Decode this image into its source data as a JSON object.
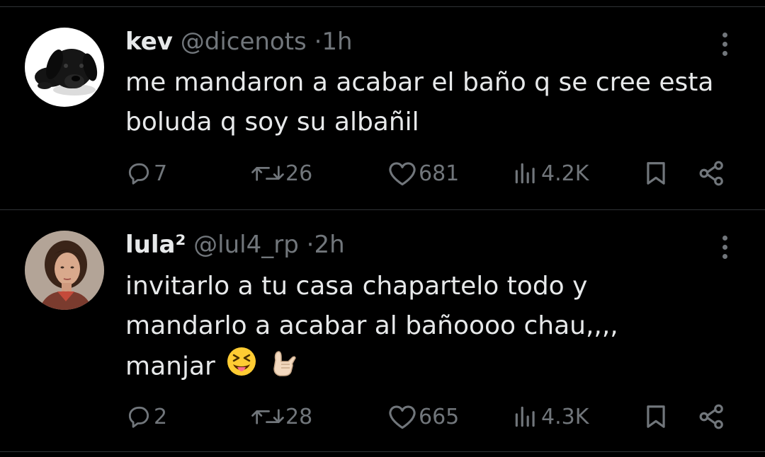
{
  "tweets": [
    {
      "name": "kev",
      "handle": "@dicenots",
      "separator": "·",
      "time": "1h",
      "text_lines": [
        "me mandaron a acabar el baño q se cree esta",
        "boluda q soy su albañil"
      ],
      "replies": "7",
      "retweets": "26",
      "likes": "681",
      "views": "4.2K",
      "avatar_icon": "black-puppy-avatar"
    },
    {
      "name": "lula²",
      "handle": "@lul4_rp",
      "separator": "·",
      "time": "2h",
      "text_lines": [
        "invitarlo a tu casa chapartelo todo y",
        "mandarlo a acabar al bañoooo chau,,,,",
        "manjar"
      ],
      "emojis": [
        "squinting-face-with-tongue-emoji",
        "call-me-hand-emoji"
      ],
      "replies": "2",
      "retweets": "28",
      "likes": "665",
      "views": "4.3K",
      "avatar_icon": "woman-portrait-avatar"
    }
  ],
  "colors": {
    "background": "#000000",
    "text": "#e7e9ea",
    "secondary": "#71767b",
    "divider": "#2f3336"
  }
}
